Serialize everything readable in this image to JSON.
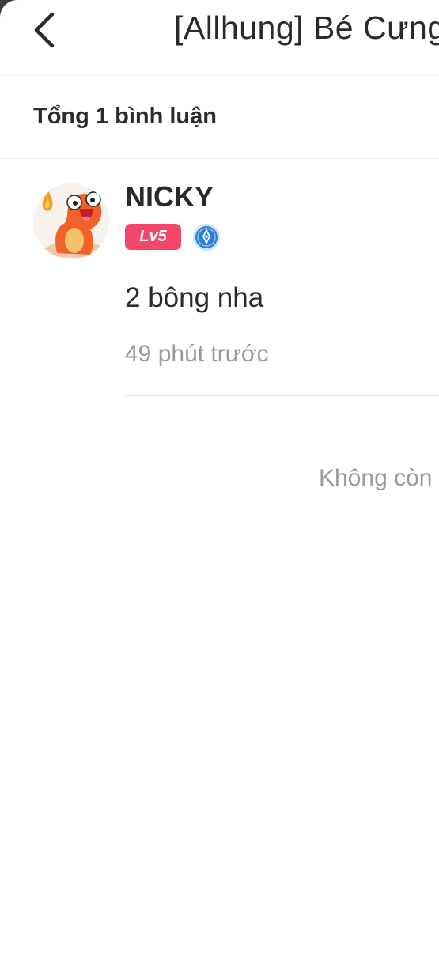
{
  "header": {
    "title": "[Allhung] Bé Cưng"
  },
  "summary": {
    "text": "Tổng 1 bình luận"
  },
  "comments": [
    {
      "username": "NICKY",
      "level": "Lv5",
      "body": "2 bông nha",
      "time": "49 phút trước"
    }
  ],
  "footer": {
    "end_text": "Không còn"
  },
  "colors": {
    "level_badge": "#f2476a",
    "medal": "#2f7fd6",
    "muted_text": "#9a9a9a"
  },
  "icons": {
    "back": "chevron-left-icon",
    "medal": "medal-icon"
  }
}
